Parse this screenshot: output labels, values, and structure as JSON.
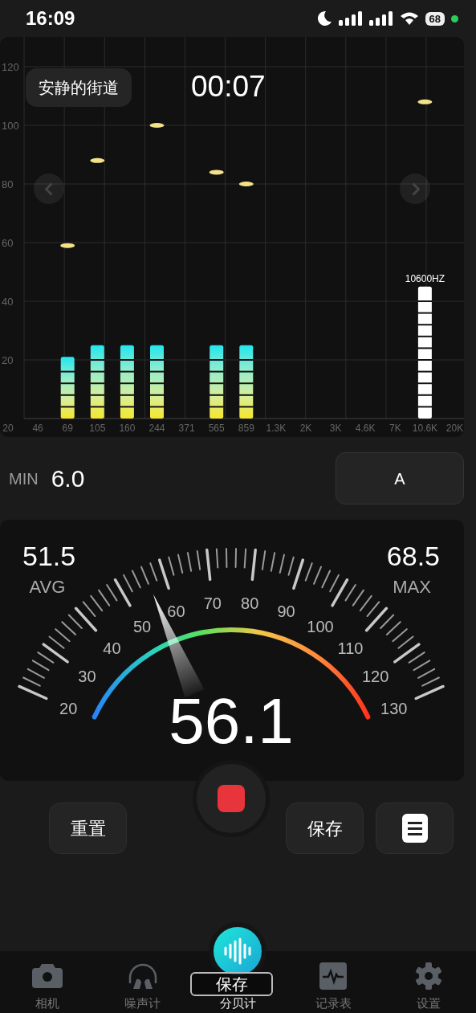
{
  "status_bar": {
    "time": "16:09",
    "battery": "68"
  },
  "spectrum": {
    "title": "安静的街道",
    "timer": "00:07",
    "chart_data": {
      "type": "bar",
      "grid": true,
      "categories": [
        "20",
        "46",
        "69",
        "105",
        "160",
        "244",
        "371",
        "565",
        "859",
        "1.3K",
        "2K",
        "3K",
        "4.6K",
        "7K",
        "10.6K",
        "20K"
      ],
      "ylim": [
        0,
        120
      ],
      "yticks": [
        20,
        40,
        60,
        80,
        100,
        120
      ],
      "series": [
        {
          "values": [
            null,
            null,
            21,
            25,
            25,
            25,
            null,
            25,
            25,
            null,
            null,
            null,
            null,
            null,
            45,
            null
          ]
        },
        {
          "type": "scatter",
          "color": "#f3e28a",
          "values": [
            null,
            null,
            59,
            88,
            null,
            100,
            null,
            84,
            80,
            null,
            null,
            null,
            null,
            null,
            108,
            null
          ]
        }
      ],
      "annotations": [
        "10600HZ"
      ]
    }
  },
  "min": {
    "label": "MIN",
    "value": "6.0"
  },
  "weighting": {
    "label": "A"
  },
  "gauge": {
    "avg": {
      "value": "51.5",
      "label": "AVG"
    },
    "max": {
      "value": "68.5",
      "label": "MAX"
    },
    "scale_labels": [
      "20",
      "30",
      "40",
      "50",
      "60",
      "70",
      "80",
      "90",
      "100",
      "110",
      "120",
      "130"
    ],
    "reading": "56.1"
  },
  "controls": {
    "reset": "重置",
    "recording": true,
    "save": "保存"
  },
  "toast": "保存",
  "nav": [
    {
      "label": "相机",
      "selected": false
    },
    {
      "label": "噪声计",
      "selected": false
    },
    {
      "label": "分贝计",
      "selected": true
    },
    {
      "label": "记录表",
      "selected": false
    },
    {
      "label": "设置",
      "selected": false
    }
  ]
}
